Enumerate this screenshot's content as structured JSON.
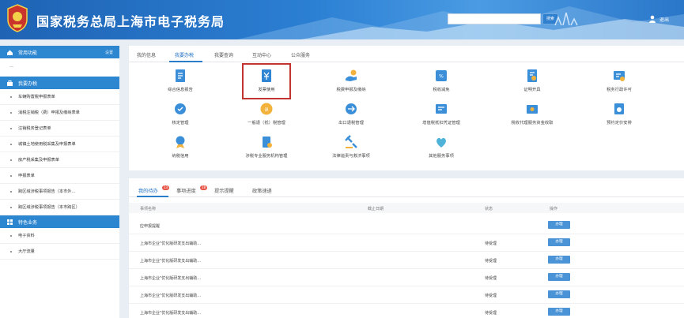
{
  "header": {
    "site_title": "国家税务总局上海市电子税务局",
    "search_placeholder": "",
    "search_button": "搜索",
    "user_label": "退出"
  },
  "sidebar": {
    "section1_title": "常用功能",
    "section1_extra": "设置",
    "section1_empty": "—",
    "section2_title": "我要办税",
    "items": [
      "车辆购置税申报表单",
      "消税注销税（费）申报及缴纳表单",
      "注销税务登记表单",
      "城镇土地使用税采集及申报表单",
      "房产税采集及申报表单",
      "申报表单",
      "跨区域涉税事项报告（本市外…",
      "跨区域涉税事项报告（本市跨区）"
    ],
    "section3_title": "特色业务",
    "items2": [
      "电子资料",
      "大厅流量"
    ]
  },
  "top_tabs": [
    "我的信息",
    "我要办税",
    "我要查询",
    "互动中心",
    "公众服务"
  ],
  "services": [
    {
      "label": "综合信息报告",
      "icon": "report-icon"
    },
    {
      "label": "发票使用",
      "icon": "invoice-icon"
    },
    {
      "label": "税费申报及缴纳",
      "icon": "tax-payment-icon"
    },
    {
      "label": "税收减免",
      "icon": "tax-relief-icon"
    },
    {
      "label": "证明开具",
      "icon": "certificate-icon"
    },
    {
      "label": "税务行政许可",
      "icon": "permit-icon"
    },
    {
      "label": "核定管理",
      "icon": "assessment-icon"
    },
    {
      "label": "一般退（抵）税管理",
      "icon": "refund-icon"
    },
    {
      "label": "出口退税管理",
      "icon": "export-refund-icon"
    },
    {
      "label": "增值税抵扣凭证管理",
      "icon": "vat-deduction-icon"
    },
    {
      "label": "税收代理服务资金收取",
      "icon": "agency-fund-icon"
    },
    {
      "label": "预约定价安排",
      "icon": "pricing-icon"
    },
    {
      "label": "纳税信用",
      "icon": "tax-credit-icon"
    },
    {
      "label": "涉税专业服务机构管理",
      "icon": "agency-mgmt-icon"
    },
    {
      "label": "法律追责与救济事项",
      "icon": "legal-icon"
    },
    {
      "label": "其他服务事项",
      "icon": "other-services-icon"
    }
  ],
  "bottom_tabs": [
    {
      "label": "我的待办",
      "badge": "13"
    },
    {
      "label": "事项进度",
      "badge": "18"
    },
    {
      "label": "提示提醒",
      "badge": ""
    },
    {
      "label": "政策速递",
      "badge": ""
    }
  ],
  "table_headers": {
    "name": "事项名称",
    "deadline": "截止日期",
    "status": "状态",
    "action": "操作"
  },
  "rows": [
    {
      "name": "应申报提醒",
      "deadline": "",
      "status": "",
      "action": "办理"
    },
    {
      "name": "上海市企业\"优化版研发支出辅助…",
      "deadline": "",
      "status": "待受理",
      "action": "办理"
    },
    {
      "name": "上海市企业\"优化版研发支出辅助…",
      "deadline": "",
      "status": "待受理",
      "action": "办理"
    },
    {
      "name": "上海市企业\"优化版研发支出辅助…",
      "deadline": "",
      "status": "待受理",
      "action": "办理"
    },
    {
      "name": "上海市企业\"优化版研发支出辅助…",
      "deadline": "",
      "status": "待受理",
      "action": "办理"
    },
    {
      "name": "上海市企业\"优化版研发支出辅助…",
      "deadline": "",
      "status": "待受理",
      "action": "办理"
    }
  ],
  "colors": {
    "header_blue": "#2b7fd3",
    "sidebar_head": "#2d86d0",
    "highlight": "#c23431",
    "button": "#4a93d6",
    "badge": "#e8584a"
  }
}
